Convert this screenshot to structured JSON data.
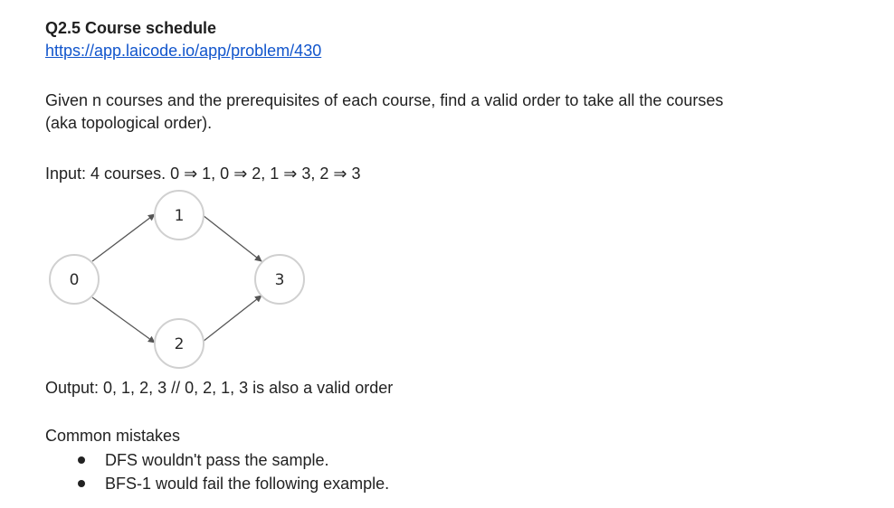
{
  "title": "Q2.5 Course schedule",
  "link": "https://app.laicode.io/app/problem/430",
  "description": {
    "line1": "Given n courses and the prerequisites of each course, find a valid order to take all the courses",
    "line2": "(aka topological order)."
  },
  "input_text": "Input: 4 courses. 0 ⇒ 1, 0 ⇒ 2, 1 ⇒ 3, 2 ⇒ 3",
  "graph": {
    "nodes": [
      "0",
      "1",
      "2",
      "3"
    ],
    "edges": [
      [
        "0",
        "1"
      ],
      [
        "0",
        "2"
      ],
      [
        "1",
        "3"
      ],
      [
        "2",
        "3"
      ]
    ]
  },
  "output_text": "Output: 0, 1, 2, 3  // 0, 2, 1, 3 is also a valid order",
  "mistakes": {
    "heading": "Common mistakes",
    "items": [
      "DFS wouldn't pass the sample.",
      "BFS-1 would fail the following example."
    ]
  },
  "colors": {
    "link": "#1155cc",
    "node_stroke": "#d0d0d0",
    "edge": "#555555"
  }
}
